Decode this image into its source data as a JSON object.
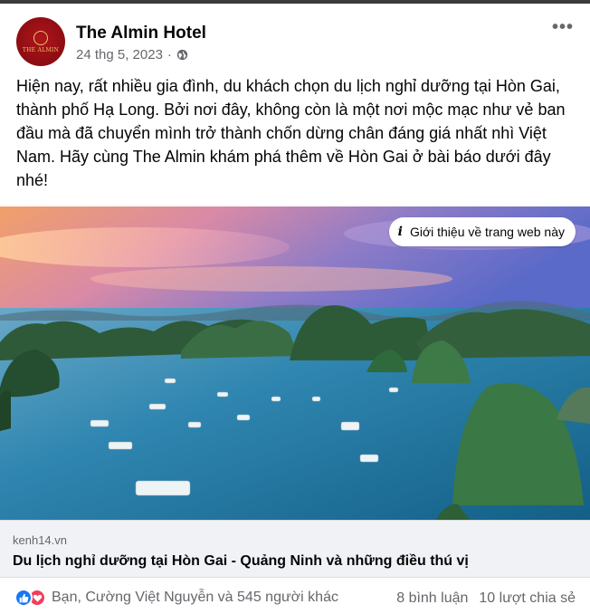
{
  "post": {
    "page_name": "The Almin Hotel",
    "date": "24 thg 5, 2023",
    "avatar_text": "THE ALMIN",
    "text": "Hiện nay, rất nhiều gia đình, du khách chọn du lịch nghỉ dưỡng tại Hòn Gai, thành phố Hạ Long. Bởi nơi đây, không còn là một nơi mộc mạc như vẻ ban đầu mà đã chuyển mình trở thành chốn dừng chân đáng giá nhất nhì Việt Nam. Hãy cùng The Almin khám phá thêm về Hòn Gai ở bài báo dưới đây nhé!",
    "more_label": "•••",
    "web_info_label": "Giới thiệu về trang web này"
  },
  "link": {
    "domain": "kenh14.vn",
    "title": "Du lịch nghỉ dưỡng tại Hòn Gai - Quảng Ninh và những điều thú vị"
  },
  "footer": {
    "reactions_text": "Bạn, Cường Việt Nguyễn và 545 người khác",
    "comments": "8 bình luận",
    "shares": "10 lượt chia sẻ"
  },
  "colors": {
    "like": "#1877f2",
    "love": "#f33e58",
    "brand": "#8c0d12"
  },
  "icons": [
    "globe-icon",
    "more-icon",
    "info-icon",
    "like-icon",
    "love-icon"
  ]
}
